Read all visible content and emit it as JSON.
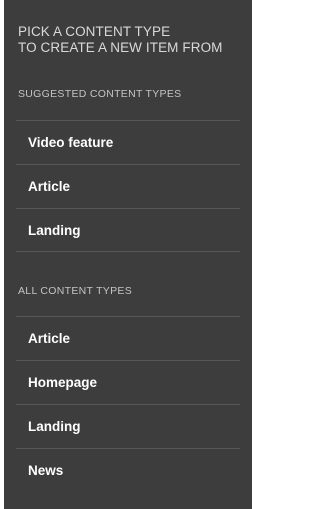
{
  "panel": {
    "heading_line1": "PICK A CONTENT TYPE",
    "heading_line2": "TO CREATE A NEW ITEM FROM",
    "suggested_label": "SUGGESTED CONTENT TYPES",
    "suggested_items": [
      {
        "label": "Video feature"
      },
      {
        "label": "Article"
      },
      {
        "label": "Landing"
      }
    ],
    "all_label": "ALL CONTENT TYPES",
    "all_items": [
      {
        "label": "Article"
      },
      {
        "label": "Homepage"
      },
      {
        "label": "Landing"
      },
      {
        "label": "News"
      }
    ]
  },
  "colors": {
    "panel_background": "#3d3d3d",
    "divider": "#565656",
    "item_text": "#ffffff",
    "label_text": "#c4c4c4"
  }
}
